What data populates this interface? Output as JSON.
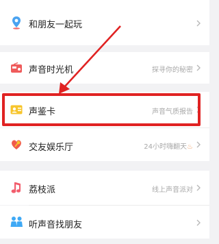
{
  "rows": {
    "play_with_friends": {
      "label": "和朋友一起玩",
      "sub": ""
    },
    "voice_time_machine": {
      "label": "声音时光机",
      "sub": "探寻你的秘密"
    },
    "voice_card": {
      "label": "声鉴卡",
      "sub": "声音气质报告"
    },
    "friend_entertainment": {
      "label": "交友娱乐厅",
      "sub": "24小时嗨翻天"
    },
    "lychee_party": {
      "label": "荔枝派",
      "sub": "线上声音派对"
    },
    "voice_find_friends": {
      "label": "听声音找朋友",
      "sub": ""
    }
  },
  "colors": {
    "accent_red": "#e02222",
    "pin_blue": "#4aa3f0",
    "radio_red": "#ef5b5b",
    "card_yellow": "#f7c52c",
    "heart_red": "#f05a4c",
    "note_pink": "#f25d6c",
    "people_blue": "#3fa9f5"
  }
}
